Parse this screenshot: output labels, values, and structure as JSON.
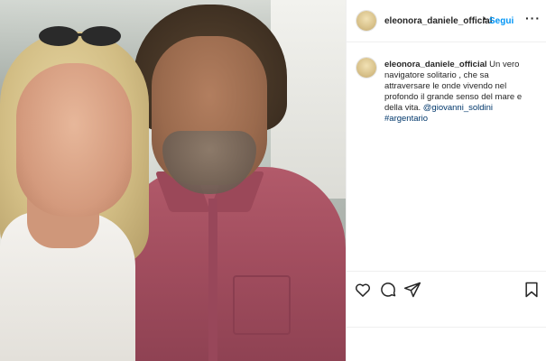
{
  "post": {
    "photo_label": "Selfie photo"
  },
  "header": {
    "username": "eleonora_daniele_official",
    "separator": "•",
    "follow_label": "Segui",
    "more_label": "···"
  },
  "caption": {
    "username": "eleonora_daniele_official",
    "text": "Un vero navigatore solitario , che sa attraversare le onde vivendo nel profondo il grande senso del mare e della vita.",
    "mention": "@giovanni_soldini",
    "hashtag": "#argentario"
  },
  "actions": {
    "like": "heart-icon",
    "comment": "comment-icon",
    "share": "share-icon",
    "save": "bookmark-icon"
  },
  "colors": {
    "accent": "#0095f6",
    "link": "#00376b",
    "text": "#262626",
    "border": "#efefef"
  }
}
